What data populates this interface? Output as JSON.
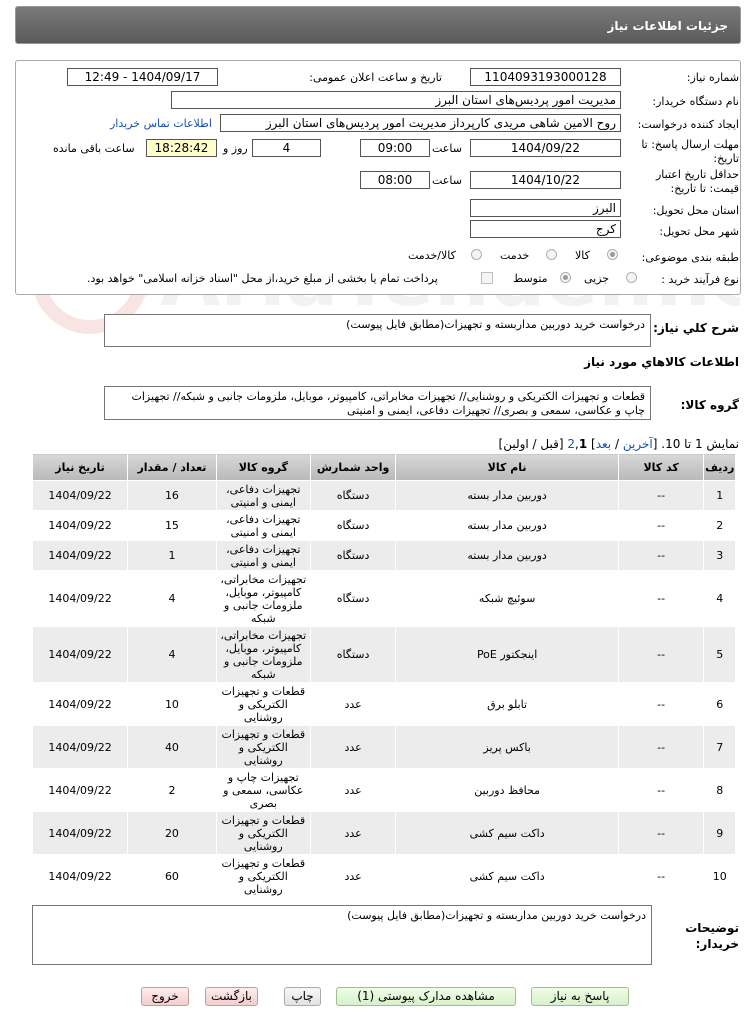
{
  "header": {
    "title": "جزئیات اطلاعات نیاز"
  },
  "form": {
    "need_number_label": "شماره نیاز:",
    "need_number": "1104093193000128",
    "announce_label": "تاریخ و ساعت اعلان عمومی:",
    "announce_value": "1404/09/17 - 12:49",
    "buyer_org_label": "نام دستگاه خریدار:",
    "buyer_org": "مدیریت امور پردیس‌های استان البرز",
    "creator_label": "ایجاد کننده درخواست:",
    "creator": "روح الامین شاهی مریدی کارپرداز مدیریت امور پردیس‌های استان البرز",
    "contact_link": "اطلاعات تماس خریدار",
    "deadline_label_1": "مهلت ارسال پاسخ: تا",
    "deadline_label_2": "تاریخ:",
    "deadline_date": "1404/09/22",
    "time_label": "ساعت",
    "deadline_time": "09:00",
    "days_value": "4",
    "days_label": "روز و",
    "remaining_time": "18:28:42",
    "remaining_label": "ساعت باقی مانده",
    "validity_label_1": "حداقل تاریخ اعتبار",
    "validity_label_2": "قیمت: تا تاریخ:",
    "validity_date": "1404/10/22",
    "validity_time": "08:00",
    "province_label": "استان محل تحویل:",
    "province": "البرز",
    "city_label": "شهر محل تحویل:",
    "city": "کرج",
    "category_label": "طبقه بندی موضوعی:",
    "category_options": [
      "کالا",
      "خدمت",
      "کالا/خدمت"
    ],
    "process_label": "نوع فرآیند خرید :",
    "process_options": [
      "جزیی",
      "متوسط"
    ],
    "payment_note": "پرداخت تمام یا بخشی از مبلغ خرید،از محل \"اسناد خزانه اسلامی\" خواهد بود."
  },
  "summary": {
    "label": "شرح کلي نياز:",
    "text": "درخواست خرید دوربین مداربسته و تجهیزات(مطابق فایل پیوست)"
  },
  "goods": {
    "section_title": "اطلاعات کالاهاي مورد نياز",
    "group_label": "گروه کالا:",
    "group_text": "قطعات و تجهیزات الکتریکی و روشنایی// تجهیزات مخابراتی، کامپیوتر، موبایل، ملزومات جانبی و شبکه// تجهیزات چاپ و عکاسی، سمعی و بصری// تجهیزات دفاعی، ایمنی و امنیتی"
  },
  "pagination": {
    "showing": "نمایش 1 تا 10.",
    "bracket_open": "[",
    "last": "آخرین",
    "sep1": "/",
    "next": "بعد",
    "bracket_close": "]",
    "page2": "2",
    "comma": ",",
    "page1": "1",
    "prev_first": "[قبل / اولین]"
  },
  "table": {
    "headers": [
      "ردیف",
      "کد کالا",
      "نام کالا",
      "واحد شمارش",
      "گروه کالا",
      "تعداد / مقدار",
      "تاریخ نیاز"
    ],
    "rows": [
      {
        "row": "1",
        "code": "--",
        "name": "دوربین مدار بسته",
        "unit": "دستگاه",
        "group": "تجهیزات دفاعی، ایمنی و امنیتی",
        "qty": "16",
        "date": "1404/09/22"
      },
      {
        "row": "2",
        "code": "--",
        "name": "دوربین مدار بسته",
        "unit": "دستگاه",
        "group": "تجهیزات دفاعی، ایمنی و امنیتی",
        "qty": "15",
        "date": "1404/09/22"
      },
      {
        "row": "3",
        "code": "--",
        "name": "دوربین مدار بسته",
        "unit": "دستگاه",
        "group": "تجهیزات دفاعی، ایمنی و امنیتی",
        "qty": "1",
        "date": "1404/09/22"
      },
      {
        "row": "4",
        "code": "--",
        "name": "سوئیچ شبکه",
        "unit": "دستگاه",
        "group": "تجهیزات مخابراتی، کامپیوتر، موبایل، ملزومات جانبی و شبکه",
        "qty": "4",
        "date": "1404/09/22"
      },
      {
        "row": "5",
        "code": "--",
        "name": "اینجکتور PoE",
        "unit": "دستگاه",
        "group": "تجهیزات مخابراتی، کامپیوتر، موبایل، ملزومات جانبی و شبکه",
        "qty": "4",
        "date": "1404/09/22"
      },
      {
        "row": "6",
        "code": "--",
        "name": "تابلو برق",
        "unit": "عدد",
        "group": "قطعات و تجهیزات الکتریکی و روشنایی",
        "qty": "10",
        "date": "1404/09/22"
      },
      {
        "row": "7",
        "code": "--",
        "name": "باکس پریز",
        "unit": "عدد",
        "group": "قطعات و تجهیزات الکتریکی و روشنایی",
        "qty": "40",
        "date": "1404/09/22"
      },
      {
        "row": "8",
        "code": "--",
        "name": "محافظ دوربین",
        "unit": "عدد",
        "group": "تجهیزات چاپ و عکاسی، سمعی و بصری",
        "qty": "2",
        "date": "1404/09/22"
      },
      {
        "row": "9",
        "code": "--",
        "name": "داکت سیم کشی",
        "unit": "عدد",
        "group": "قطعات و تجهیزات الکتریکی و روشنایی",
        "qty": "20",
        "date": "1404/09/22"
      },
      {
        "row": "10",
        "code": "--",
        "name": "داکت سیم کشی",
        "unit": "عدد",
        "group": "قطعات و تجهیزات الکتریکی و روشنایی",
        "qty": "60",
        "date": "1404/09/22"
      }
    ]
  },
  "buyer_notes": {
    "label_1": "توضیحات",
    "label_2": "خریدار:",
    "text": "درخواست خرید دوربین مداربسته و تجهیزات(مطابق فایل پیوست)"
  },
  "buttons": {
    "reply": "پاسخ به نیاز",
    "view_docs": "مشاهده مدارک پیوستی (1)",
    "print": "چاپ",
    "back": "بازگشت",
    "exit": "خروج"
  },
  "watermark": {
    "text": "AriaTender.neT"
  }
}
